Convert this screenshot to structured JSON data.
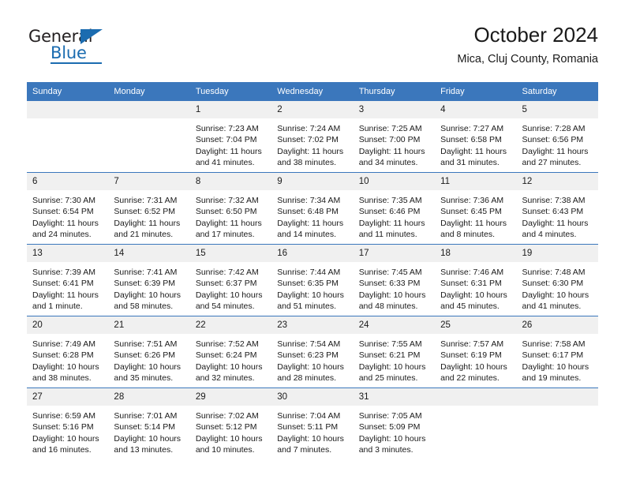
{
  "brand": {
    "name_top": "General",
    "name_bottom": "Blue"
  },
  "header": {
    "title": "October 2024",
    "subtitle": "Mica, Cluj County, Romania"
  },
  "colors": {
    "header_blue": "#3b77bc",
    "daynum_band": "#f0f0f0",
    "brand_blue": "#1b6cb0",
    "text": "#1a1a1a"
  },
  "calendar": {
    "weekday_headers": [
      "Sunday",
      "Monday",
      "Tuesday",
      "Wednesday",
      "Thursday",
      "Friday",
      "Saturday"
    ],
    "weeks": [
      [
        {
          "day": "",
          "lines": []
        },
        {
          "day": "",
          "lines": []
        },
        {
          "day": "1",
          "lines": [
            "Sunrise: 7:23 AM",
            "Sunset: 7:04 PM",
            "Daylight: 11 hours",
            "and 41 minutes."
          ]
        },
        {
          "day": "2",
          "lines": [
            "Sunrise: 7:24 AM",
            "Sunset: 7:02 PM",
            "Daylight: 11 hours",
            "and 38 minutes."
          ]
        },
        {
          "day": "3",
          "lines": [
            "Sunrise: 7:25 AM",
            "Sunset: 7:00 PM",
            "Daylight: 11 hours",
            "and 34 minutes."
          ]
        },
        {
          "day": "4",
          "lines": [
            "Sunrise: 7:27 AM",
            "Sunset: 6:58 PM",
            "Daylight: 11 hours",
            "and 31 minutes."
          ]
        },
        {
          "day": "5",
          "lines": [
            "Sunrise: 7:28 AM",
            "Sunset: 6:56 PM",
            "Daylight: 11 hours",
            "and 27 minutes."
          ]
        }
      ],
      [
        {
          "day": "6",
          "lines": [
            "Sunrise: 7:30 AM",
            "Sunset: 6:54 PM",
            "Daylight: 11 hours",
            "and 24 minutes."
          ]
        },
        {
          "day": "7",
          "lines": [
            "Sunrise: 7:31 AM",
            "Sunset: 6:52 PM",
            "Daylight: 11 hours",
            "and 21 minutes."
          ]
        },
        {
          "day": "8",
          "lines": [
            "Sunrise: 7:32 AM",
            "Sunset: 6:50 PM",
            "Daylight: 11 hours",
            "and 17 minutes."
          ]
        },
        {
          "day": "9",
          "lines": [
            "Sunrise: 7:34 AM",
            "Sunset: 6:48 PM",
            "Daylight: 11 hours",
            "and 14 minutes."
          ]
        },
        {
          "day": "10",
          "lines": [
            "Sunrise: 7:35 AM",
            "Sunset: 6:46 PM",
            "Daylight: 11 hours",
            "and 11 minutes."
          ]
        },
        {
          "day": "11",
          "lines": [
            "Sunrise: 7:36 AM",
            "Sunset: 6:45 PM",
            "Daylight: 11 hours",
            "and 8 minutes."
          ]
        },
        {
          "day": "12",
          "lines": [
            "Sunrise: 7:38 AM",
            "Sunset: 6:43 PM",
            "Daylight: 11 hours",
            "and 4 minutes."
          ]
        }
      ],
      [
        {
          "day": "13",
          "lines": [
            "Sunrise: 7:39 AM",
            "Sunset: 6:41 PM",
            "Daylight: 11 hours",
            "and 1 minute."
          ]
        },
        {
          "day": "14",
          "lines": [
            "Sunrise: 7:41 AM",
            "Sunset: 6:39 PM",
            "Daylight: 10 hours",
            "and 58 minutes."
          ]
        },
        {
          "day": "15",
          "lines": [
            "Sunrise: 7:42 AM",
            "Sunset: 6:37 PM",
            "Daylight: 10 hours",
            "and 54 minutes."
          ]
        },
        {
          "day": "16",
          "lines": [
            "Sunrise: 7:44 AM",
            "Sunset: 6:35 PM",
            "Daylight: 10 hours",
            "and 51 minutes."
          ]
        },
        {
          "day": "17",
          "lines": [
            "Sunrise: 7:45 AM",
            "Sunset: 6:33 PM",
            "Daylight: 10 hours",
            "and 48 minutes."
          ]
        },
        {
          "day": "18",
          "lines": [
            "Sunrise: 7:46 AM",
            "Sunset: 6:31 PM",
            "Daylight: 10 hours",
            "and 45 minutes."
          ]
        },
        {
          "day": "19",
          "lines": [
            "Sunrise: 7:48 AM",
            "Sunset: 6:30 PM",
            "Daylight: 10 hours",
            "and 41 minutes."
          ]
        }
      ],
      [
        {
          "day": "20",
          "lines": [
            "Sunrise: 7:49 AM",
            "Sunset: 6:28 PM",
            "Daylight: 10 hours",
            "and 38 minutes."
          ]
        },
        {
          "day": "21",
          "lines": [
            "Sunrise: 7:51 AM",
            "Sunset: 6:26 PM",
            "Daylight: 10 hours",
            "and 35 minutes."
          ]
        },
        {
          "day": "22",
          "lines": [
            "Sunrise: 7:52 AM",
            "Sunset: 6:24 PM",
            "Daylight: 10 hours",
            "and 32 minutes."
          ]
        },
        {
          "day": "23",
          "lines": [
            "Sunrise: 7:54 AM",
            "Sunset: 6:23 PM",
            "Daylight: 10 hours",
            "and 28 minutes."
          ]
        },
        {
          "day": "24",
          "lines": [
            "Sunrise: 7:55 AM",
            "Sunset: 6:21 PM",
            "Daylight: 10 hours",
            "and 25 minutes."
          ]
        },
        {
          "day": "25",
          "lines": [
            "Sunrise: 7:57 AM",
            "Sunset: 6:19 PM",
            "Daylight: 10 hours",
            "and 22 minutes."
          ]
        },
        {
          "day": "26",
          "lines": [
            "Sunrise: 7:58 AM",
            "Sunset: 6:17 PM",
            "Daylight: 10 hours",
            "and 19 minutes."
          ]
        }
      ],
      [
        {
          "day": "27",
          "lines": [
            "Sunrise: 6:59 AM",
            "Sunset: 5:16 PM",
            "Daylight: 10 hours",
            "and 16 minutes."
          ]
        },
        {
          "day": "28",
          "lines": [
            "Sunrise: 7:01 AM",
            "Sunset: 5:14 PM",
            "Daylight: 10 hours",
            "and 13 minutes."
          ]
        },
        {
          "day": "29",
          "lines": [
            "Sunrise: 7:02 AM",
            "Sunset: 5:12 PM",
            "Daylight: 10 hours",
            "and 10 minutes."
          ]
        },
        {
          "day": "30",
          "lines": [
            "Sunrise: 7:04 AM",
            "Sunset: 5:11 PM",
            "Daylight: 10 hours",
            "and 7 minutes."
          ]
        },
        {
          "day": "31",
          "lines": [
            "Sunrise: 7:05 AM",
            "Sunset: 5:09 PM",
            "Daylight: 10 hours",
            "and 3 minutes."
          ]
        },
        {
          "day": "",
          "lines": []
        },
        {
          "day": "",
          "lines": []
        }
      ]
    ]
  }
}
